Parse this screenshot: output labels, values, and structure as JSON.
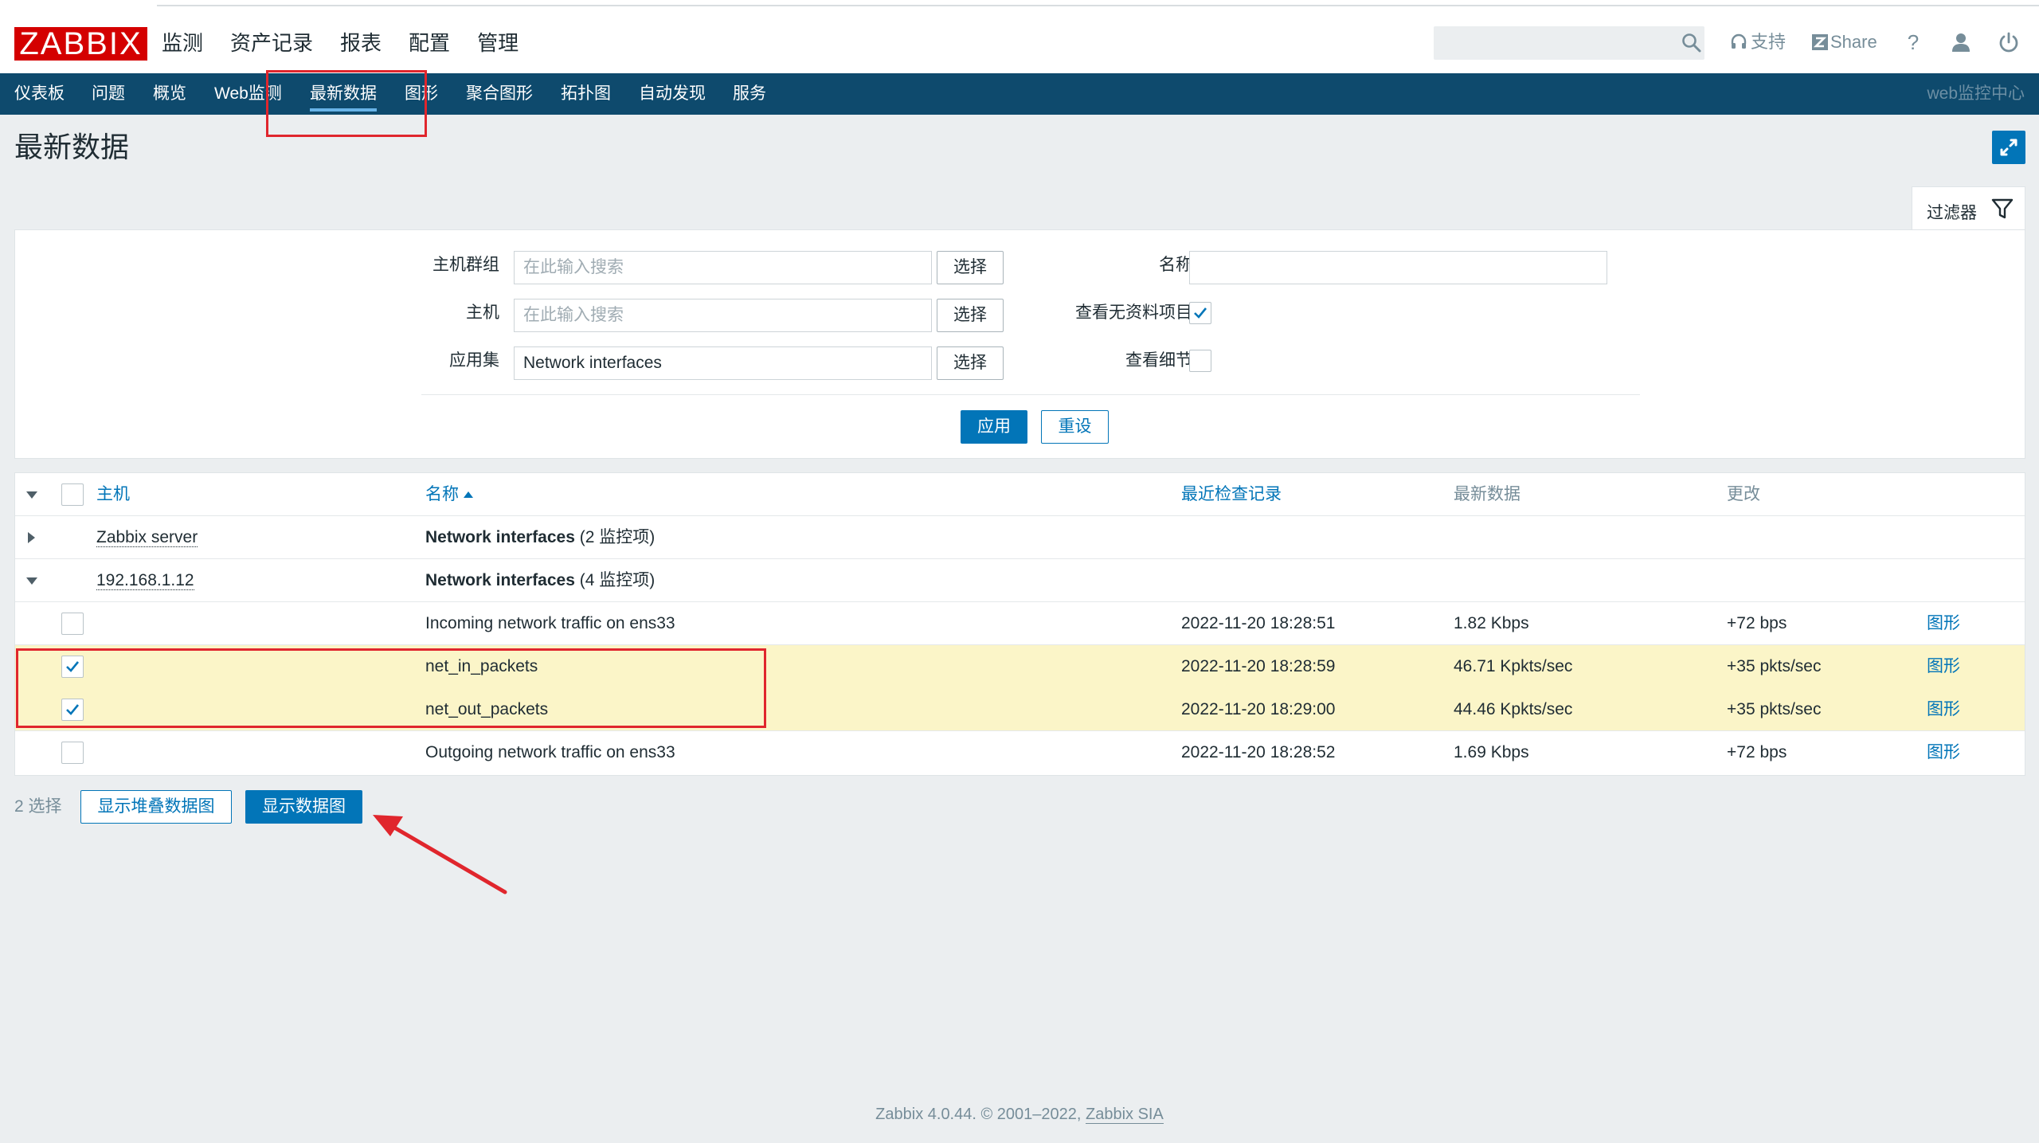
{
  "colors": {
    "brand": "#d40000",
    "nav": "#0e4a6d",
    "accent": "#0275b8",
    "selected_row": "#fbf5c8",
    "annotation": "#e0262d"
  },
  "logo": "ZABBIX",
  "main_menu": [
    "监测",
    "资产记录",
    "报表",
    "配置",
    "管理"
  ],
  "header": {
    "search_placeholder": "",
    "support_label": "支持",
    "share_label": "Share",
    "help_label": "?",
    "icons": [
      "search-icon",
      "headset-icon",
      "share-icon",
      "help-icon",
      "user-icon",
      "power-icon"
    ]
  },
  "sub_menu": [
    "仪表板",
    "问题",
    "概览",
    "Web监测",
    "最新数据",
    "图形",
    "聚合图形",
    "拓扑图",
    "自动发现",
    "服务"
  ],
  "sub_menu_right": "web监控中心",
  "page_title": "最新数据",
  "filter": {
    "tab_label": "过滤器",
    "host_group_label": "主机群组",
    "host_group_placeholder": "在此输入搜索",
    "host_label": "主机",
    "host_placeholder": "在此输入搜索",
    "application_label": "应用集",
    "application_value": "Network interfaces",
    "select_label": "选择",
    "name_label": "名称",
    "name_value": "",
    "show_no_data_label": "查看无资料项目",
    "show_no_data_checked": true,
    "show_details_label": "查看细节",
    "show_details_checked": false,
    "apply_label": "应用",
    "reset_label": "重设"
  },
  "table": {
    "headers": {
      "host": "主机",
      "name": "名称",
      "last_check": "最近检查记录",
      "last_value": "最新数据",
      "change": "更改"
    },
    "groups": [
      {
        "host": "Zabbix server",
        "app_name": "Network interfaces",
        "app_count": "(2 监控项)",
        "expanded": false
      },
      {
        "host": "192.168.1.12",
        "app_name": "Network interfaces",
        "app_count": "(4 监控项)",
        "expanded": true
      }
    ],
    "items": [
      {
        "name": "Incoming network traffic on ens33",
        "last_check": "2022-11-20 18:28:51",
        "last_value": "1.82 Kbps",
        "change": "+72 bps",
        "graph": "图形",
        "checked": false
      },
      {
        "name": "net_in_packets",
        "last_check": "2022-11-20 18:28:59",
        "last_value": "46.71 Kpkts/sec",
        "change": "+35 pkts/sec",
        "graph": "图形",
        "checked": true
      },
      {
        "name": "net_out_packets",
        "last_check": "2022-11-20 18:29:00",
        "last_value": "44.46 Kpkts/sec",
        "change": "+35 pkts/sec",
        "graph": "图形",
        "checked": true
      },
      {
        "name": "Outgoing network traffic on ens33",
        "last_check": "2022-11-20 18:28:52",
        "last_value": "1.69 Kbps",
        "change": "+72 bps",
        "graph": "图形",
        "checked": false
      }
    ]
  },
  "actions": {
    "selected_count": "2 选择",
    "stacked_graph": "显示堆叠数据图",
    "graph": "显示数据图"
  },
  "footer": {
    "text": "Zabbix 4.0.44. © 2001–2022, ",
    "link": "Zabbix SIA"
  }
}
